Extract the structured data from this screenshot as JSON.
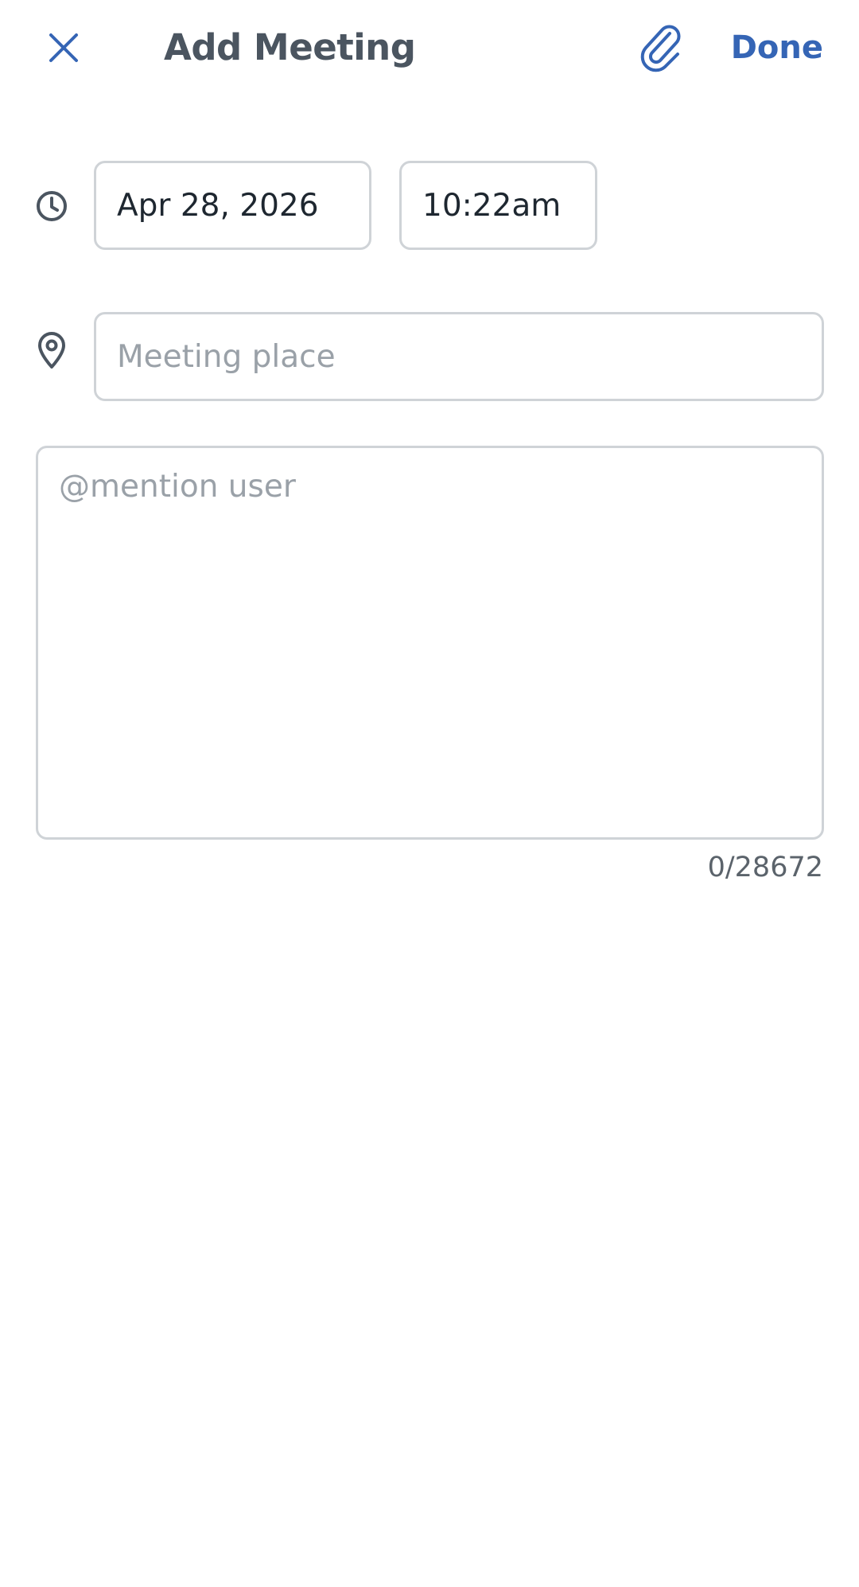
{
  "header": {
    "title": "Add Meeting",
    "done_label": "Done",
    "close_icon": "close-icon",
    "attach_icon": "paperclip-icon"
  },
  "datetime": {
    "icon": "clock-icon",
    "date_value": "Apr 28, 2026",
    "time_value": "10:22am"
  },
  "place": {
    "icon": "location-pin-icon",
    "placeholder": "Meeting place",
    "value": ""
  },
  "notes": {
    "placeholder": "@mention user",
    "value": "",
    "counter": "0/28672"
  },
  "colors": {
    "accent": "#3565b5",
    "title": "#4b5560",
    "border": "#cfd3d7",
    "placeholder": "#9aa1a8"
  }
}
